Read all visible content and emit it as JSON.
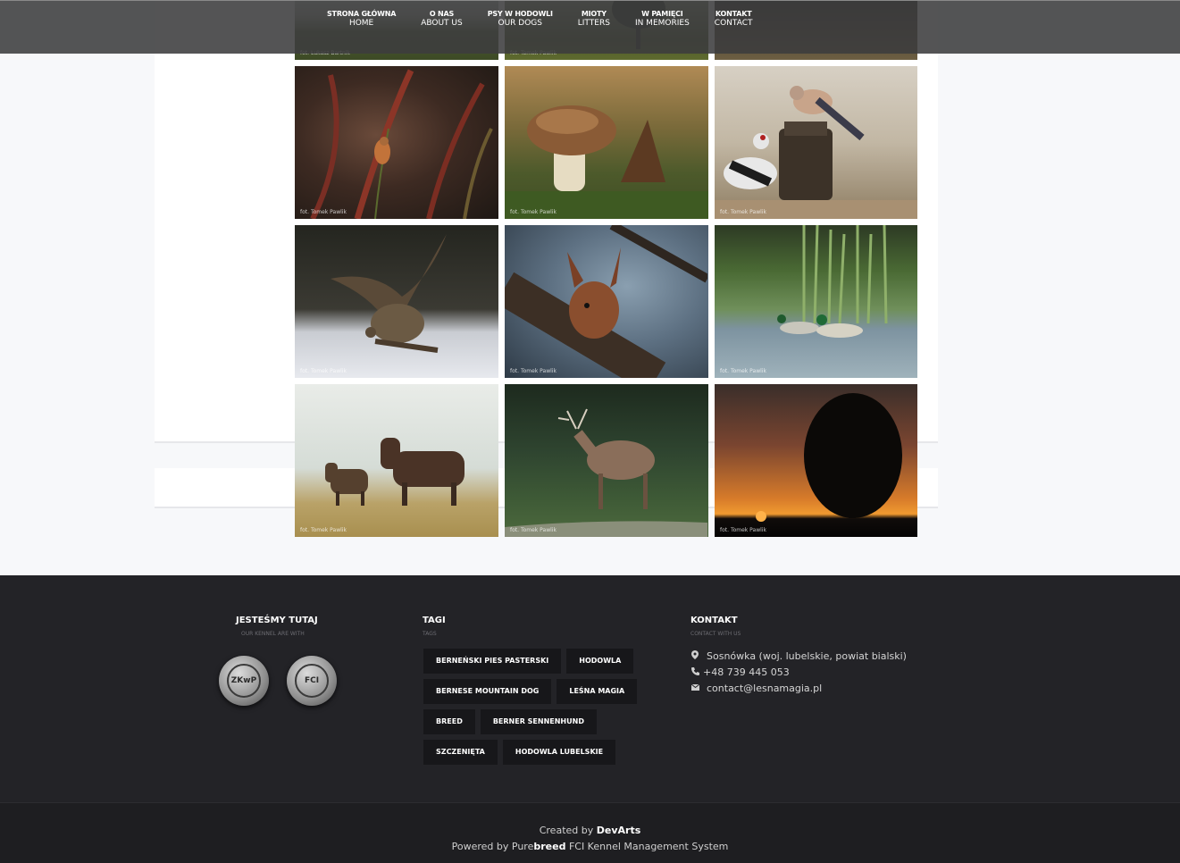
{
  "nav": {
    "items": [
      {
        "pl": "STRONA GŁÓWNA",
        "en": "HOME"
      },
      {
        "pl": "O NAS",
        "en": "ABOUT US"
      },
      {
        "pl": "PSY W HODOWLI",
        "en": "OUR DOGS"
      },
      {
        "pl": "MIOTY",
        "en": "LITTERS"
      },
      {
        "pl": "W PAMIĘCI",
        "en": "IN MEMORIES"
      },
      {
        "pl": "KONTAKT",
        "en": "CONTACT"
      }
    ]
  },
  "gallery": {
    "credit": "fot. Tomek Pawlik",
    "credit_first_left": "fot. Łukasz Bartnik",
    "credit_first_mid": "fot. Tomek Pawlik",
    "items": [
      {
        "subject": "manor-house-park"
      },
      {
        "subject": "tree-field"
      },
      {
        "subject": "dark-landscape"
      },
      {
        "subject": "bird-in-reeds"
      },
      {
        "subject": "mushroom"
      },
      {
        "subject": "jay-and-woodpecker"
      },
      {
        "subject": "buzzard-in-frost"
      },
      {
        "subject": "red-squirrel"
      },
      {
        "subject": "mallard-ducks"
      },
      {
        "subject": "moose-in-fog"
      },
      {
        "subject": "roaring-deer"
      },
      {
        "subject": "sunset-tree"
      }
    ]
  },
  "footer": {
    "col1": {
      "title": "JESTEŚMY TUTAJ",
      "subtitle": "OUR KENNEL ARE WITH",
      "badge1": "ZKwP",
      "badge2": "FCI"
    },
    "col2": {
      "title": "TAGI",
      "subtitle": "TAGS",
      "tags": [
        [
          "BERNEŃSKI PIES PASTERSKI",
          "HODOWLA"
        ],
        [
          "BERNESE MOUNTAIN DOG",
          "LEŚNA MAGIA"
        ],
        [
          "BREED",
          "BERNER SENNENHUND"
        ],
        [
          "SZCZENIĘTA",
          "HODOWLA LUBELSKIE"
        ]
      ]
    },
    "col3": {
      "title": "KONTAKT",
      "subtitle": "CONTACT WITH US",
      "address": "Sosnówka (woj. lubelskie, powiat bialski)",
      "phone": "+48 739 445 053",
      "email": "contact@lesnamagia.pl"
    },
    "created_prefix": "Created by",
    "created_by": "DevArts",
    "powered_prefix": "Powered by Pure",
    "powered_brand": "breed",
    "powered_suffix": "FCI Kennel Management System"
  }
}
